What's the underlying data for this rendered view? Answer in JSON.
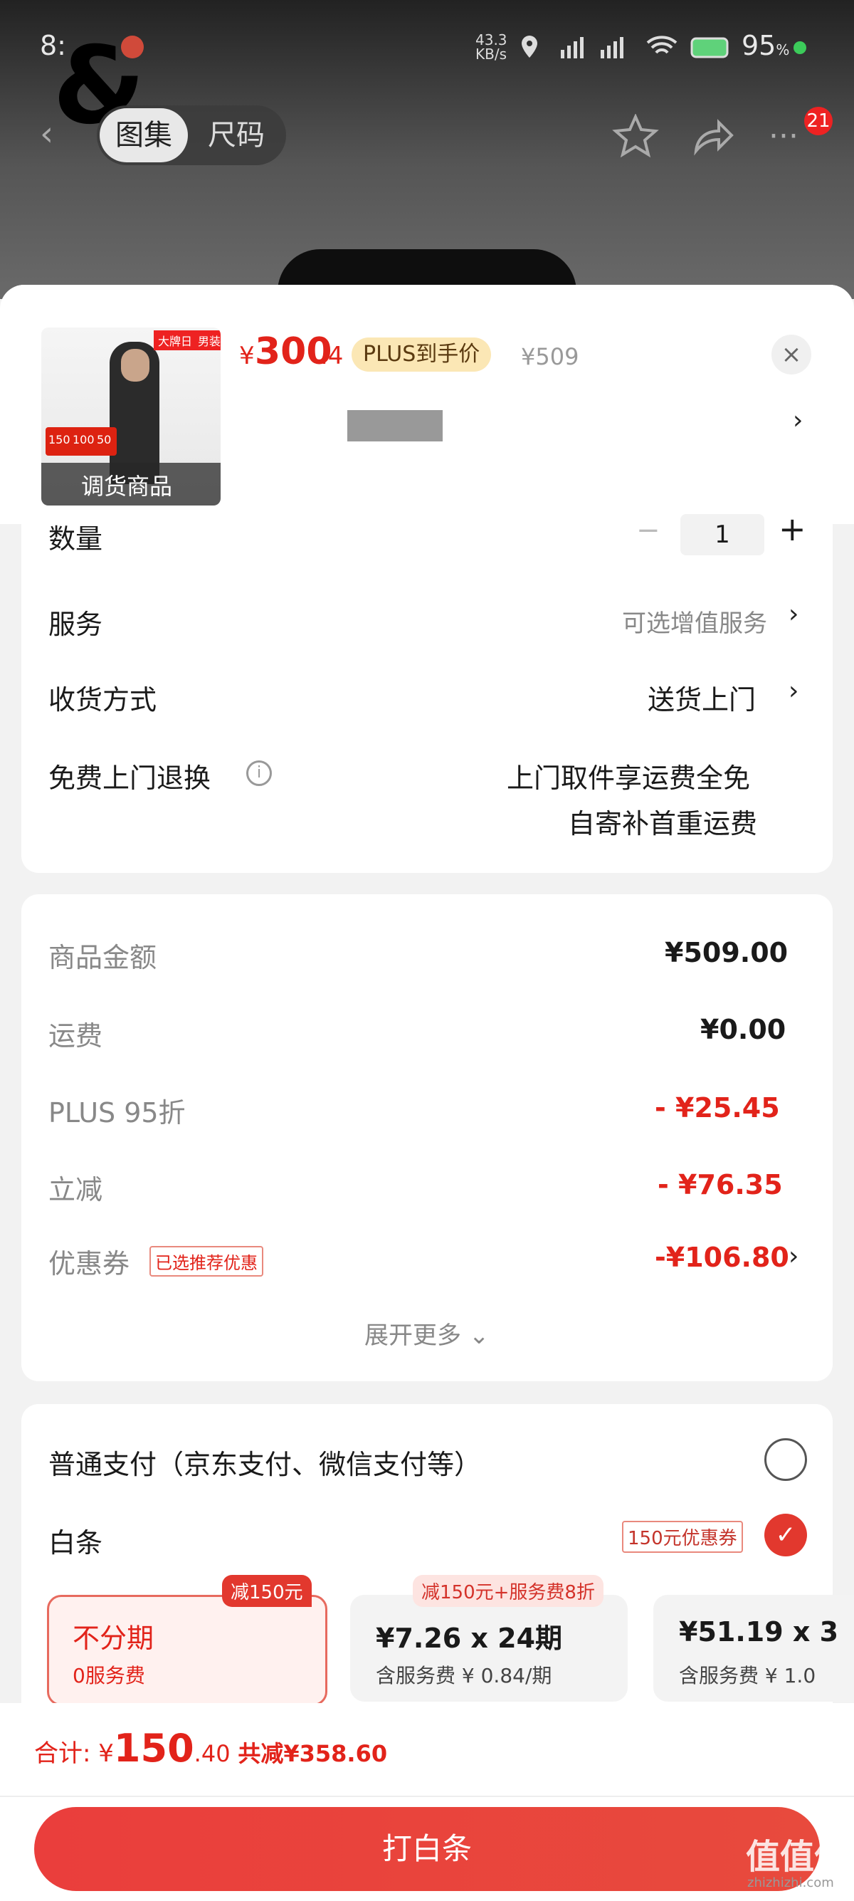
{
  "status_bar": {
    "time": "8:",
    "net_speed": "43.3\nKB/s",
    "battery": "95",
    "battery_unit": "%"
  },
  "nav": {
    "tabs": [
      "图集",
      "尺码"
    ],
    "badge": "21"
  },
  "product": {
    "price_symbol": "¥",
    "price_main": "300",
    "price_decimal": ".4",
    "plus_tag": "PLUS到手价",
    "original_price": "¥509",
    "thumb_tags": [
      "大牌日",
      "男装节"
    ],
    "thumb_overlay": "调货商品",
    "thumb_coupons": [
      "150",
      "100",
      "50"
    ]
  },
  "quantity": {
    "label": "数量",
    "value": "1",
    "minus": "−",
    "plus": "+"
  },
  "service": {
    "label": "服务",
    "value": "可选增值服务"
  },
  "delivery": {
    "label": "收货方式",
    "value": "送货上门"
  },
  "returns": {
    "label": "免费上门退换",
    "line1": "上门取件享运费全免",
    "line2": "自寄补首重运费"
  },
  "amounts": {
    "goods_label": "商品金额",
    "goods_value": "¥509.00",
    "shipping_label": "运费",
    "shipping_value": "¥0.00",
    "plus_label": "PLUS 95折",
    "plus_value": "- ¥25.45",
    "instant_label": "立减",
    "instant_value": "- ¥76.35",
    "coupon_label": "优惠券",
    "coupon_tag": "已选推荐优惠",
    "coupon_value": "-¥106.80",
    "expand": "展开更多"
  },
  "payment": {
    "normal_label": "普通支付（京东支付、微信支付等）",
    "baitiao_label": "白条",
    "baitiao_coupon": "150元优惠券",
    "plans": [
      {
        "badge": "减150元",
        "title": "不分期",
        "sub": "0服务费"
      },
      {
        "badge": "减150元+服务费8折",
        "title": "¥7.26 x 24期",
        "sub": "含服务费 ¥ 0.84/期"
      },
      {
        "title": "¥51.19 x 3",
        "sub": "含服务费 ¥ 1.0"
      }
    ]
  },
  "footer": {
    "total_label": "合计:",
    "total_symbol": "¥",
    "total_main": "150",
    "total_decimal": ".40",
    "saved": "共减¥358.60",
    "cta": "打白条"
  },
  "watermark": {
    "brand": "值值值",
    "url": "zhizhizhi.com"
  },
  "colors": {
    "accent": "#e2231a",
    "plus_tag_bg": "#fbe7b5",
    "cta": "#e8433c"
  }
}
